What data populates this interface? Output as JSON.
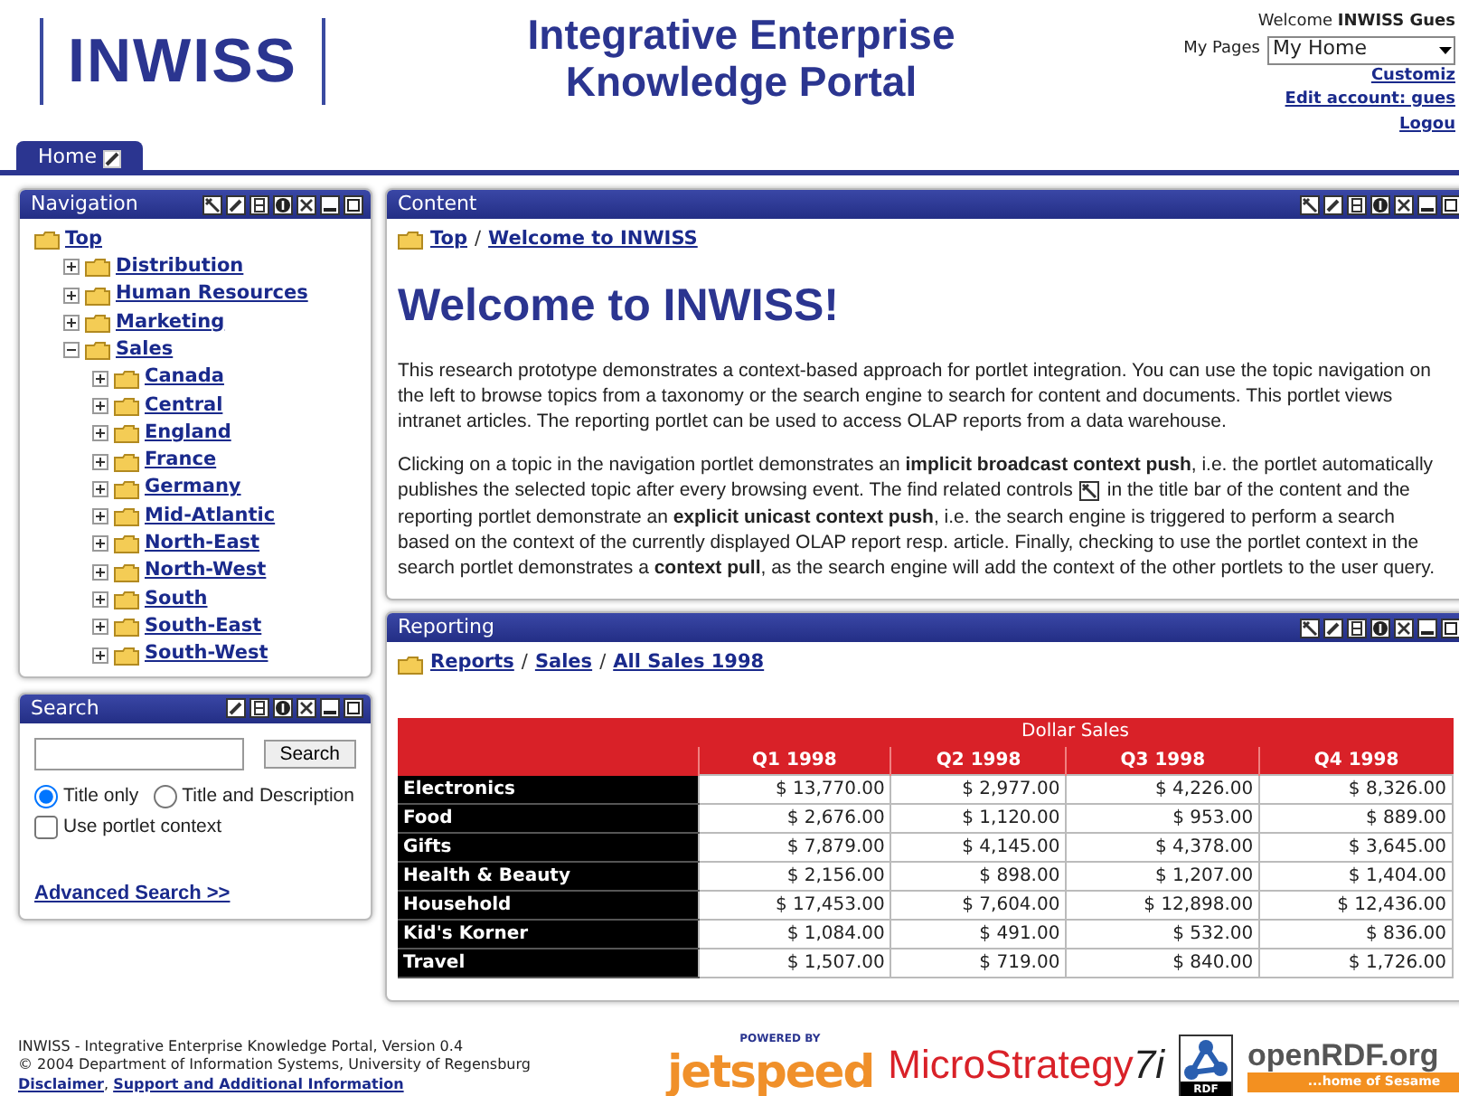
{
  "header": {
    "logo": "INWISS",
    "title_lines": [
      "Integrative Enterprise",
      "Knowledge Portal"
    ],
    "welcome": "Welcome **INWISS Gues**",
    "my_pages_label": "My Pages",
    "my_pages_value": "My Home",
    "links": [
      "Customiz",
      "Edit account: gues",
      "Logou"
    ]
  },
  "tabs": [
    {
      "label": "Home",
      "selected": true
    }
  ],
  "navigation": {
    "title": "Navigation",
    "find_related": true,
    "tree": [
      {
        "label": "Top",
        "children": [
          {
            "label": "Distribution",
            "expanded": false
          },
          {
            "label": "Human Resources",
            "expanded": false
          },
          {
            "label": "Marketing",
            "expanded": false
          },
          {
            "label": "Sales",
            "expanded": true,
            "children": [
              {
                "label": "Canada",
                "expanded": false
              },
              {
                "label": "Central",
                "expanded": false
              },
              {
                "label": "England",
                "expanded": false
              },
              {
                "label": "France",
                "expanded": false
              },
              {
                "label": "Germany",
                "expanded": false
              },
              {
                "label": "Mid-Atlantic",
                "expanded": false
              },
              {
                "label": "North-East",
                "expanded": false
              },
              {
                "label": "North-West",
                "expanded": false
              },
              {
                "label": "South",
                "expanded": false
              },
              {
                "label": "South-East",
                "expanded": false
              },
              {
                "label": "South-West",
                "expanded": false
              }
            ]
          }
        ]
      }
    ]
  },
  "search": {
    "title": "Search",
    "find_related": false,
    "button": "Search",
    "options": [
      {
        "label": "Title only",
        "selected": true
      },
      {
        "label": "Title and Description",
        "selected": false
      }
    ],
    "context_checkbox": {
      "label": "Use portlet context",
      "checked": false
    },
    "advanced_link": "Advanced Search >>"
  },
  "content": {
    "title": "Content",
    "find_related": true,
    "breadcrumb": [
      "Top",
      "Welcome to INWISS"
    ],
    "separator": "/",
    "heading": "Welcome to INWISS!",
    "paragraph_1": "This research prototype demonstrates a context-based approach for portlet integration. You can use the topic navigation on the left to browse topics from a taxonomy or the search engine to search for content and documents. This portlet views intranet articles. The reporting portlet can be used to access OLAP reports from a data warehouse.",
    "paragraph_2_lines": [
      {
        "text": "Clicking on a topic in the navigation portlet demonstrates an **implicit broadcast context push**, i.e. the portlet automatically"
      },
      {
        "text": "publishes the selected topic after every browsing event. The find related controls",
        "after_icon": "in the title bar of the content and the"
      },
      {
        "text": "reporting portlet demonstrate an **explicit unicast context push**, i.e. the search engine is triggered to perform a search"
      },
      {
        "text": "based on the context of the currently displayed OLAP report resp. article.  Finally, checking to use the portlet context in the"
      },
      {
        "text": "search portlet demonstrates a **context pull**, as the search engine will add the context of the other portlets to the user query."
      }
    ]
  },
  "reporting": {
    "title": "Reporting",
    "find_related": true,
    "breadcrumb": [
      "Reports",
      "Sales",
      "All Sales 1998"
    ],
    "separator": "/",
    "table": {
      "group_header": "Dollar Sales",
      "columns": [
        "Q1 1998",
        "Q2 1998",
        "Q3 1998",
        "Q4 1998"
      ],
      "rows": [
        {
          "label": "Electronics",
          "values": [
            "$ 13,770.00",
            "$ 2,977.00",
            "$ 4,226.00",
            "$ 8,326.00"
          ]
        },
        {
          "label": "Food",
          "values": [
            "$ 2,676.00",
            "$ 1,120.00",
            "$ 953.00",
            "$ 889.00"
          ]
        },
        {
          "label": "Gifts",
          "values": [
            "$ 7,879.00",
            "$ 4,145.00",
            "$ 4,378.00",
            "$ 3,645.00"
          ]
        },
        {
          "label": "Health & Beauty",
          "values": [
            "$ 2,156.00",
            "$ 898.00",
            "$ 1,207.00",
            "$ 1,404.00"
          ]
        },
        {
          "label": "Household",
          "values": [
            "$ 17,453.00",
            "$ 7,604.00",
            "$ 12,898.00",
            "$ 12,436.00"
          ]
        },
        {
          "label": "Kid's Korner",
          "values": [
            "$ 1,084.00",
            "$ 491.00",
            "$ 532.00",
            "$ 836.00"
          ]
        },
        {
          "label": "Travel",
          "values": [
            "$ 1,507.00",
            "$ 719.00",
            "$ 840.00",
            "$ 1,726.00"
          ]
        }
      ]
    }
  },
  "footer": {
    "lines": [
      "INWISS - Integrative Enterprise Knowledge Portal, Version 0.4",
      "© 2004 Department of Information Systems, University of Regensburg"
    ],
    "links": [
      "Disclaimer",
      "Support and Additional Information"
    ],
    "link_separator": ",",
    "logos": {
      "jetspeed_tag": "POWERED BY",
      "jetspeed": "jetspeed",
      "microstrategy": "MicroStrategy",
      "microstrategy_version": "7i",
      "rdf": "RDF",
      "openrdf": "openRDF.org",
      "sesame": "...home of Sesame"
    }
  }
}
